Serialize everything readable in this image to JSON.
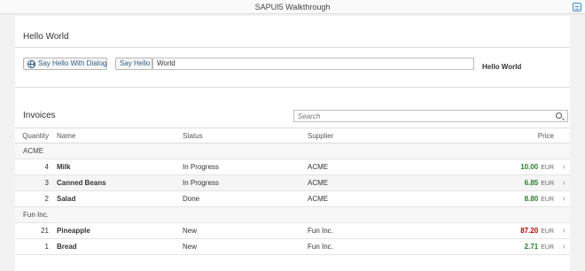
{
  "app": {
    "title": "SAPUI5 Walkthrough"
  },
  "hello_panel": {
    "title": "Hello World",
    "dialog_button": "Say Hello With Dialog",
    "hello_button": "Say Hello",
    "input_value": "World",
    "output_text": "Hello World"
  },
  "invoices": {
    "title": "Invoices",
    "search_placeholder": "Search",
    "columns": {
      "quantity": "Quantity",
      "name": "Name",
      "status": "Status",
      "supplier": "Supplier",
      "price": "Price"
    },
    "groups": [
      {
        "name": "ACME",
        "rows": [
          {
            "quantity": "4",
            "name": "Milk",
            "status": "In Progress",
            "supplier": "ACME",
            "price": "10.00",
            "currency": "EUR",
            "price_state": "green"
          },
          {
            "quantity": "3",
            "name": "Canned Beans",
            "status": "In Progress",
            "supplier": "ACME",
            "price": "6.85",
            "currency": "EUR",
            "price_state": "green"
          },
          {
            "quantity": "2",
            "name": "Salad",
            "status": "Done",
            "supplier": "ACME",
            "price": "8.80",
            "currency": "EUR",
            "price_state": "green"
          }
        ]
      },
      {
        "name": "Fun Inc.",
        "rows": [
          {
            "quantity": "21",
            "name": "Pineapple",
            "status": "New",
            "supplier": "Fun Inc.",
            "price": "87.20",
            "currency": "EUR",
            "price_state": "red"
          },
          {
            "quantity": "1",
            "name": "Bread",
            "status": "New",
            "supplier": "Fun Inc.",
            "price": "2.71",
            "currency": "EUR",
            "price_state": "green"
          }
        ]
      }
    ]
  },
  "colors": {
    "positive": "#2b7d2b",
    "negative": "#bb0000",
    "accent": "#346187"
  }
}
